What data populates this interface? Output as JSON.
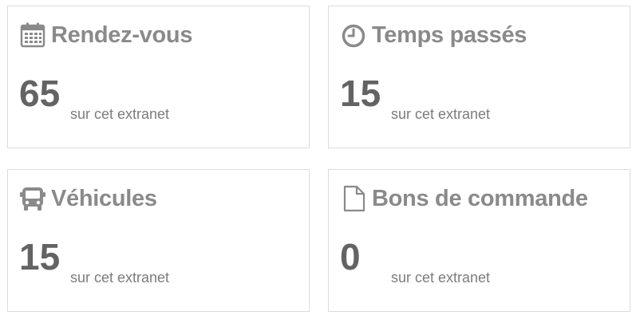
{
  "cards": [
    {
      "icon": "calendar-icon",
      "title": "Rendez-vous",
      "value": "65",
      "subtitle": "sur cet extranet"
    },
    {
      "icon": "clock-icon",
      "title": "Temps passés",
      "value": "15",
      "subtitle": "sur cet extranet"
    },
    {
      "icon": "bus-icon",
      "title": "Véhicules",
      "value": "15",
      "subtitle": "sur cet extranet"
    },
    {
      "icon": "document-icon",
      "title": "Bons de commande",
      "value": "0",
      "subtitle": "sur cet extranet"
    }
  ],
  "colors": {
    "title": "#8a8a8a",
    "value": "#636363",
    "subtitle": "#7c7c7c",
    "border": "#dcdcdc",
    "icon": "#8a8a8a"
  }
}
